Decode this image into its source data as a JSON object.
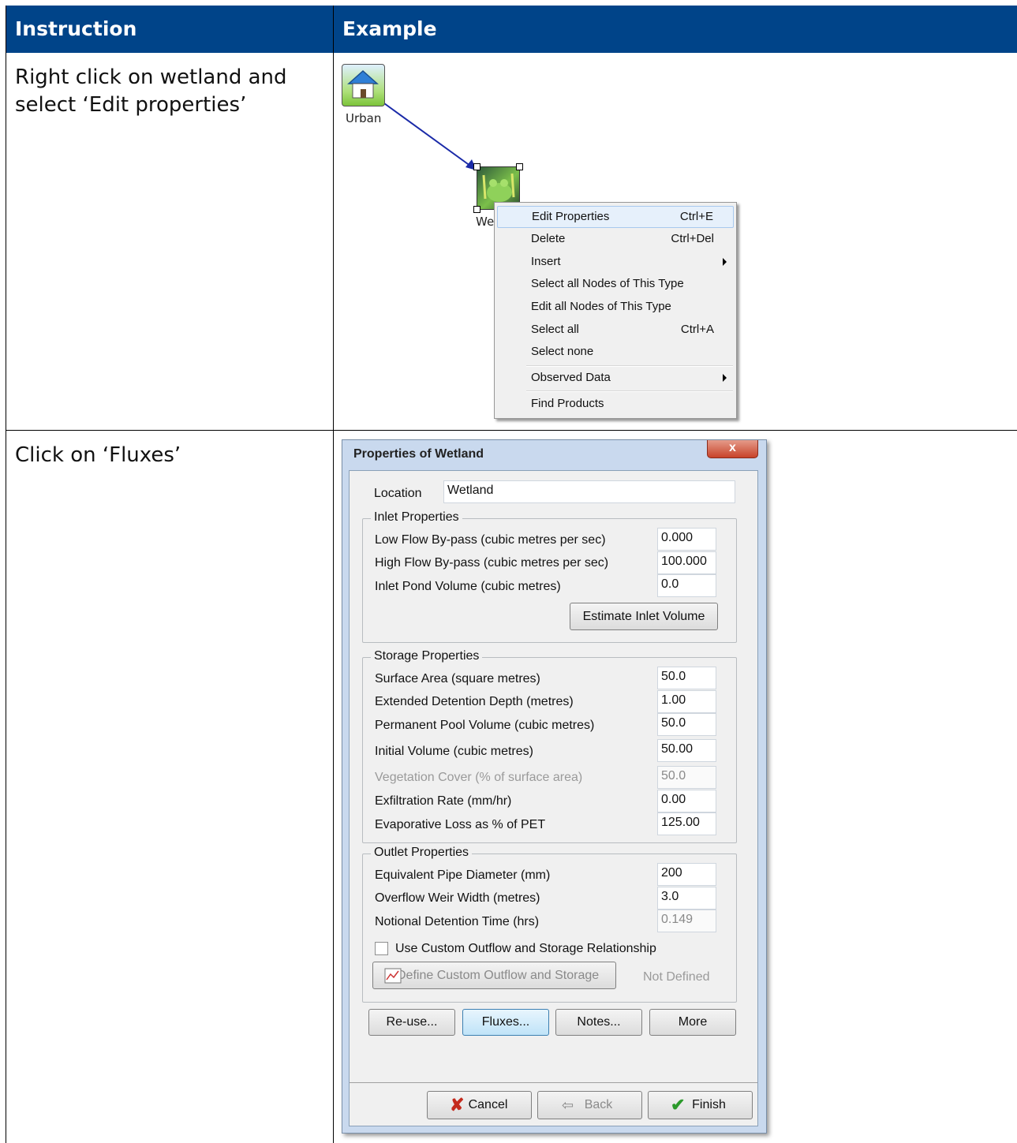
{
  "table": {
    "header_instruction": "Instruction",
    "header_example": "Example",
    "row1_instruction_line1": "Right click on wetland and",
    "row1_instruction_line2": "select ‘Edit properties’",
    "row2_instruction": "Click on ‘Fluxes’"
  },
  "diagram": {
    "urban_label": "Urban",
    "wetland_label": "We"
  },
  "context_menu": {
    "items": [
      {
        "label": "Edit Properties",
        "shortcut": "Ctrl+E"
      },
      {
        "label": "Delete",
        "shortcut": "Ctrl+Del"
      },
      {
        "label": "Insert",
        "shortcut": ""
      },
      {
        "label": "Select all Nodes of This Type",
        "shortcut": ""
      },
      {
        "label": "Edit all Nodes of This Type",
        "shortcut": ""
      },
      {
        "label": "Select all",
        "shortcut": "Ctrl+A"
      },
      {
        "label": "Select none",
        "shortcut": ""
      },
      {
        "label": "Observed Data",
        "shortcut": ""
      },
      {
        "label": "Find Products",
        "shortcut": ""
      }
    ]
  },
  "dialog": {
    "title": "Properties of Wetland",
    "close": "x",
    "location_label": "Location",
    "location_value": "Wetland",
    "inlet": {
      "title": "Inlet Properties",
      "low_flow_label": "Low Flow By-pass (cubic metres per sec)",
      "low_flow_value": "0.000",
      "high_flow_label": "High Flow By-pass (cubic metres per sec)",
      "high_flow_value": "100.000",
      "pond_volume_label": "Inlet Pond Volume (cubic metres)",
      "pond_volume_value": "0.0",
      "estimate_button": "Estimate Inlet Volume"
    },
    "storage": {
      "title": "Storage Properties",
      "surface_area_label": "Surface Area (square metres)",
      "surface_area_value": "50.0",
      "ext_depth_label": "Extended Detention Depth (metres)",
      "ext_depth_value": "1.00",
      "perm_pool_label": "Permanent Pool Volume (cubic metres)",
      "perm_pool_value": "50.0",
      "initial_volume_label": "Initial Volume (cubic metres)",
      "initial_volume_value": "50.00",
      "veg_cover_label": "Vegetation Cover (% of surface area)",
      "veg_cover_value": "50.0",
      "exfil_label": "Exfiltration Rate (mm/hr)",
      "exfil_value": "0.00",
      "evap_label": "Evaporative Loss as % of PET",
      "evap_value": "125.00"
    },
    "outlet": {
      "title": "Outlet Properties",
      "pipe_label": "Equivalent Pipe Diameter (mm)",
      "pipe_value": "200",
      "weir_label": "Overflow Weir Width (metres)",
      "weir_value": "3.0",
      "detention_label": "Notional Detention Time (hrs)",
      "detention_value": "0.149",
      "custom_check_label": "Use Custom Outflow and Storage Relationship",
      "define_button": "Define Custom Outflow and Storage",
      "not_defined": "Not Defined"
    },
    "buttons": {
      "reuse": "Re-use...",
      "fluxes": "Fluxes...",
      "notes": "Notes...",
      "more": "More",
      "cancel": "Cancel",
      "back": "Back",
      "finish": "Finish"
    }
  }
}
